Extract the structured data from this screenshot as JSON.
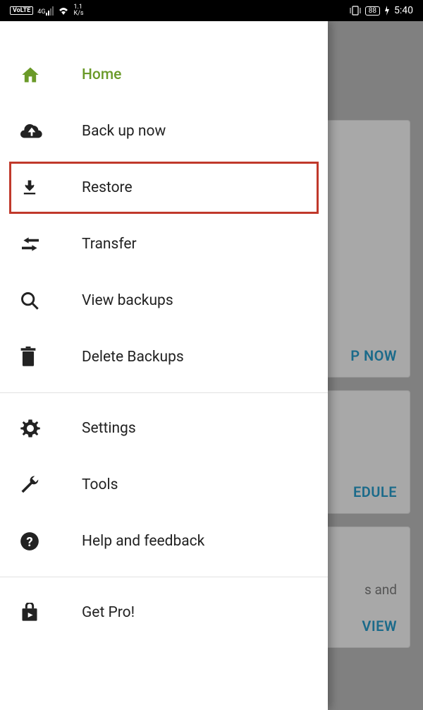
{
  "status": {
    "volte": "VoLTE",
    "net_type": "4G",
    "speed_top": "1.1",
    "speed_bottom": "K/s",
    "battery": "88",
    "time": "5:40"
  },
  "drawer": {
    "items": [
      {
        "label": "Home"
      },
      {
        "label": "Back up now"
      },
      {
        "label": "Restore"
      },
      {
        "label": "Transfer"
      },
      {
        "label": "View backups"
      },
      {
        "label": "Delete Backups"
      },
      {
        "label": "Settings"
      },
      {
        "label": "Tools"
      },
      {
        "label": "Help and feedback"
      },
      {
        "label": "Get Pro!"
      }
    ]
  },
  "background": {
    "btn1": "P NOW",
    "btn2": "EDULE",
    "frag": "s and",
    "btn3": "VIEW"
  }
}
